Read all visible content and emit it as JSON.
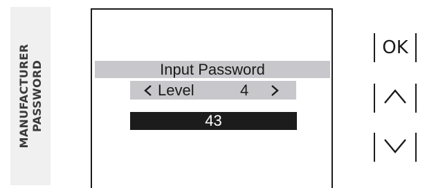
{
  "side_label": "MANUFACTURER\nPASSWORD",
  "screen": {
    "title": "Input Password",
    "level_label": "Level",
    "level_value": "4",
    "password_value": "43",
    "left_icon": "chevron-left-icon",
    "right_icon": "chevron-right-icon"
  },
  "buttons": {
    "ok_label": "OK",
    "up_icon": "arrow-up-icon",
    "down_icon": "arrow-down-icon"
  },
  "colors": {
    "highlight_bar": "#c8c8cc",
    "selected_field": "#1c1c1c",
    "side_tab": "#f0f0f0",
    "text": "#1a1a1a"
  }
}
